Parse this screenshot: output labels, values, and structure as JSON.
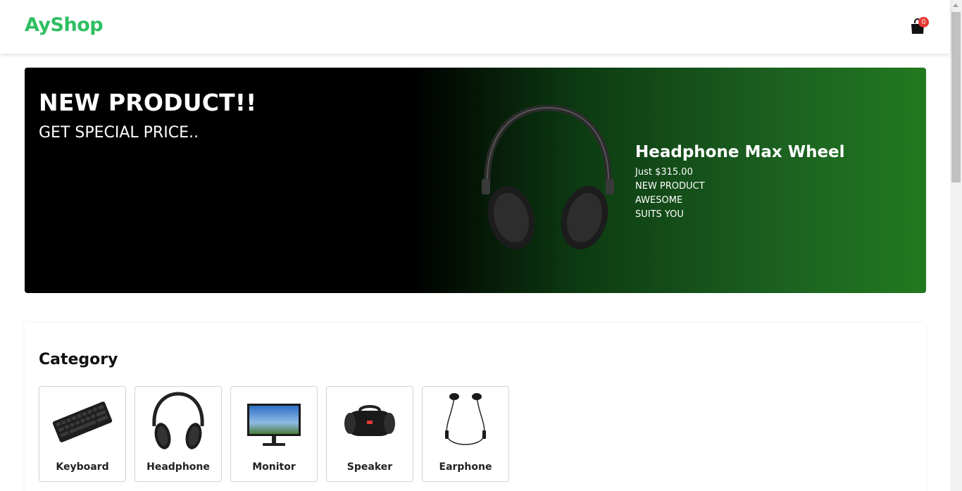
{
  "header": {
    "brand": "AyShop",
    "cart_count": "0",
    "cart_icon": "shopping-bag-icon"
  },
  "hero": {
    "title": "NEW PRODUCT!!",
    "subtitle": "GET SPECIAL PRICE..",
    "product": {
      "name": "Headphone Max Wheel",
      "price": "Just $315.00",
      "tags": [
        "NEW PRODUCT",
        "AWESOME",
        "SUITS YOU"
      ]
    }
  },
  "category": {
    "title": "Category",
    "items": [
      {
        "label": "Keyboard",
        "icon": "keyboard-icon"
      },
      {
        "label": "Headphone",
        "icon": "headphone-icon"
      },
      {
        "label": "Monitor",
        "icon": "monitor-icon"
      },
      {
        "label": "Speaker",
        "icon": "speaker-icon"
      },
      {
        "label": "Earphone",
        "icon": "earphone-icon"
      }
    ]
  },
  "colors": {
    "brand": "#2fbf62",
    "hero_gradient_end": "#22791f",
    "badge": "#e53935"
  }
}
